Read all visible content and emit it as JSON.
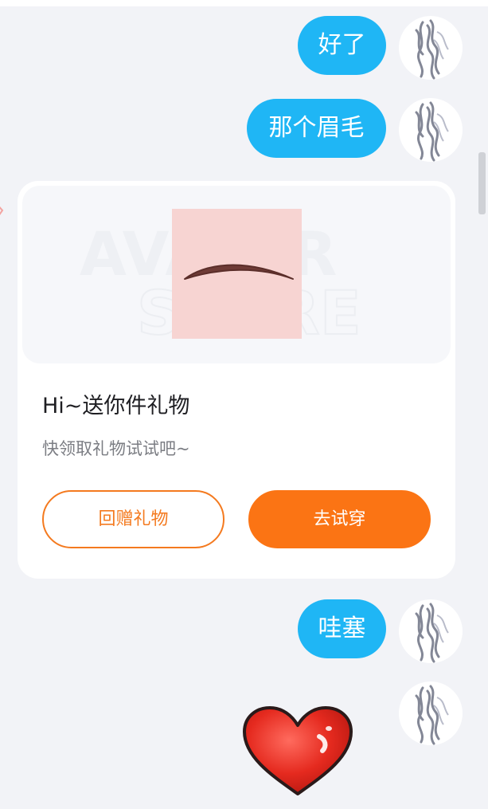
{
  "messages": [
    {
      "text": "好了"
    },
    {
      "text": "那个眉毛"
    },
    {
      "text": "哇塞"
    }
  ],
  "gift_card": {
    "title": "Hi~送你件礼物",
    "subtitle": "快领取礼物试试吧~",
    "return_gift_label": "回赠礼物",
    "try_on_label": "去试穿",
    "watermark_line1": "AVATAR",
    "watermark_line2": "STORE"
  },
  "colors": {
    "bubble": "#1fb6f5",
    "accent_orange": "#fb7414",
    "background": "#f2f3f7",
    "card": "#ffffff"
  },
  "icons": {
    "avatar": "ink-portrait-avatar",
    "item": "eyebrow-item-icon",
    "sticker": "red-heart-sticker"
  }
}
